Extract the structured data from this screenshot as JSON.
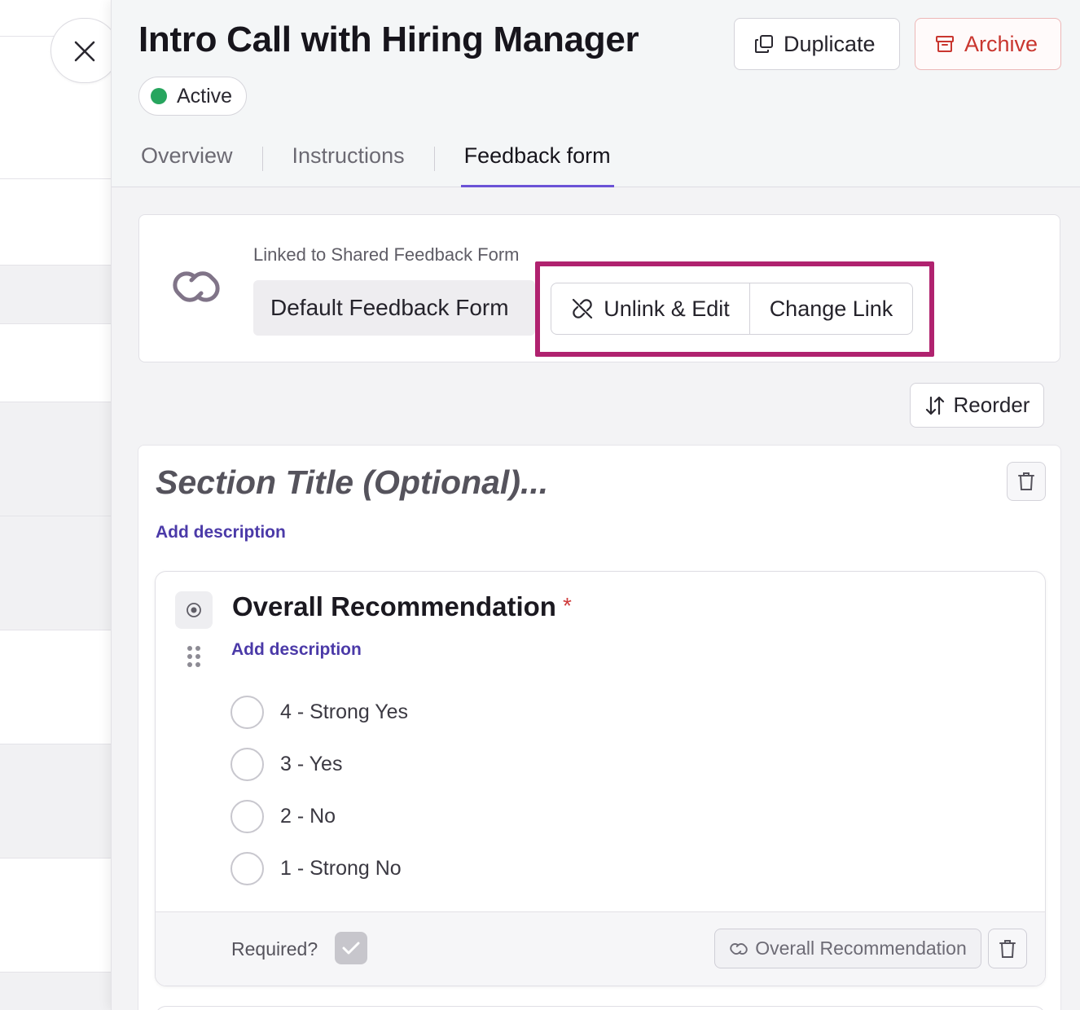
{
  "header": {
    "title": "Intro Call with Hiring Manager",
    "status": "Active",
    "duplicate_label": "Duplicate",
    "archive_label": "Archive"
  },
  "tabs": [
    {
      "label": "Overview",
      "active": false
    },
    {
      "label": "Instructions",
      "active": false
    },
    {
      "label": "Feedback form",
      "active": true
    }
  ],
  "linked_form": {
    "caption": "Linked to Shared Feedback Form",
    "form_name": "Default Feedback Form",
    "unlink_label": "Unlink & Edit",
    "change_label": "Change Link"
  },
  "reorder_label": "Reorder",
  "section": {
    "title_placeholder": "Section Title (Optional)...",
    "add_description": "Add description"
  },
  "question": {
    "title": "Overall Recommendation",
    "required_mark": "*",
    "add_description": "Add description",
    "options": [
      "4 - Strong Yes",
      "3 - Yes",
      "2 - No",
      "1 - Strong No"
    ],
    "required_label": "Required?",
    "linked_field_label": "Overall Recommendation"
  },
  "colors": {
    "accent": "#6b52d6",
    "archive": "#c9362f",
    "status_active": "#27a55e",
    "highlight": "#b0226f",
    "link_text": "#4b3aa8"
  },
  "icons": [
    "close-icon",
    "duplicate-icon",
    "archive-icon",
    "link-icon",
    "unlink-icon",
    "sort-icon",
    "trash-icon",
    "radio-type-icon",
    "drag-handle-icon",
    "check-icon"
  ]
}
